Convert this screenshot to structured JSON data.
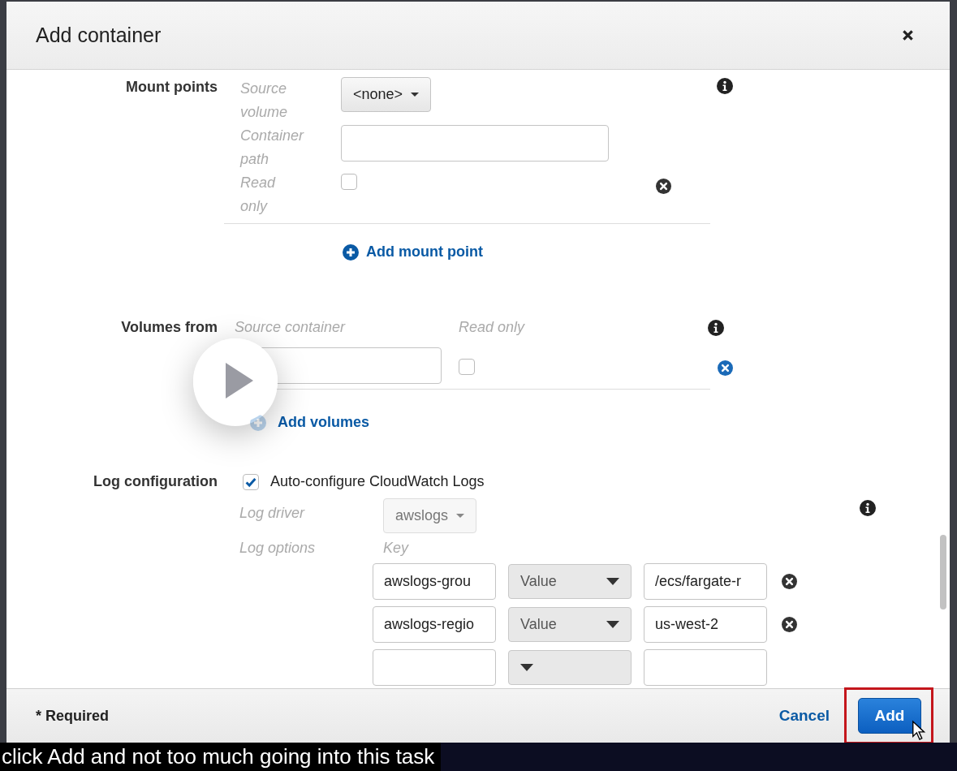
{
  "dialog": {
    "title": "Add container"
  },
  "mount_points": {
    "label": "Mount points",
    "fields": [
      {
        "kind": "select",
        "label": "Source volume",
        "value": "<none>"
      },
      {
        "kind": "input",
        "label": "Container path"
      },
      {
        "kind": "checkbox",
        "label": "Read only",
        "checked": false
      }
    ],
    "add_link": "Add mount point"
  },
  "volumes_from": {
    "label": "Volumes from",
    "columns": [
      "Source container",
      "Read only"
    ],
    "rows": [
      {
        "read_only": false
      }
    ],
    "add_link": "Add volumes"
  },
  "log_configuration": {
    "label": "Log configuration",
    "auto_configure": {
      "label": "Auto-configure CloudWatch Logs",
      "checked": true
    },
    "log_driver": {
      "label": "Log driver",
      "value": "awslogs",
      "disabled": true
    },
    "log_options": {
      "label": "Log options",
      "key_header": "Key",
      "rows": [
        {
          "key": "awslogs-grou",
          "type": "Value",
          "value": "/ecs/fargate-r"
        },
        {
          "key": "awslogs-regio",
          "type": "Value",
          "value": "us-west-2"
        },
        {}
      ]
    }
  },
  "footer": {
    "required_note": "* Required",
    "cancel": "Cancel",
    "add": "Add",
    "add_highlighted": true
  },
  "caption": "click Add and not too much going into this task"
}
